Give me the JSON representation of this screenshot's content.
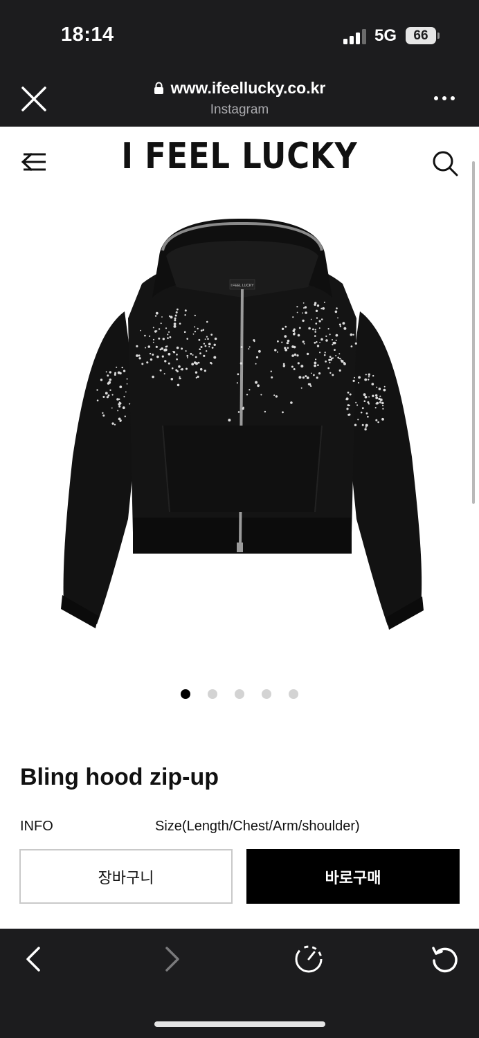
{
  "status_bar": {
    "time": "18:14",
    "network": "5G",
    "battery": "66"
  },
  "browser": {
    "url": "www.ifeellucky.co.kr",
    "source": "Instagram"
  },
  "site": {
    "logo": "I FEEL LUCKY"
  },
  "product": {
    "image_label": "I FEEL LUCKY",
    "title": "Bling hood zip-up",
    "info_label": "INFO",
    "size_label": "Size(Length/Chest/Arm/shoulder)",
    "carousel_total": 5,
    "carousel_active": 1
  },
  "actions": {
    "cart_label": "장바구니",
    "buy_label": "바로구매"
  },
  "colors": {
    "dark_bar": "#1c1c1e",
    "buy_button": "#000000",
    "text": "#111111"
  }
}
